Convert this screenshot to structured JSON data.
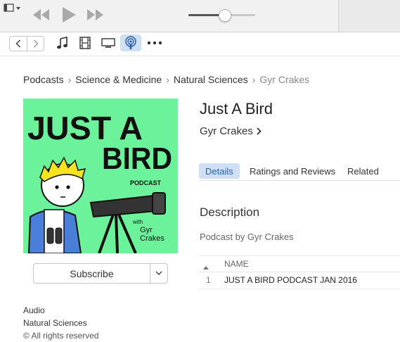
{
  "window": {
    "volume_level": 0.55
  },
  "toolbar": {
    "media_kinds": [
      "music",
      "movies",
      "tv-shows",
      "podcasts",
      "more"
    ],
    "selected_media": "podcasts"
  },
  "breadcrumb": {
    "items": [
      "Podcasts",
      "Science & Medicine",
      "Natural Sciences"
    ],
    "current": "Gyr Crakes"
  },
  "artwork": {
    "line1": "JUST A",
    "line2": "BIRD",
    "tag": "PODCAST",
    "with": "with",
    "credit_line1": "Gyr",
    "credit_line2": "Crakes",
    "background_color": "#6cf29a"
  },
  "subscribe": {
    "label": "Subscribe"
  },
  "meta": {
    "kind": "Audio",
    "genre": "Natural Sciences",
    "rights": "© All rights reserved"
  },
  "podcast": {
    "title": "Just A Bird",
    "author": "Gyr Crakes"
  },
  "tabs": [
    {
      "label": "Details",
      "selected": true
    },
    {
      "label": "Ratings and Reviews",
      "selected": false
    },
    {
      "label": "Related",
      "selected": false
    }
  ],
  "description": {
    "heading": "Description",
    "text": "Podcast by Gyr Crakes"
  },
  "episodes": {
    "column_name": "NAME",
    "rows": [
      {
        "number": "1",
        "name": "JUST A BIRD PODCAST JAN 2016"
      }
    ]
  },
  "colors": {
    "accent": "#2a5ea8",
    "selection_bg": "#cfe0f5"
  }
}
